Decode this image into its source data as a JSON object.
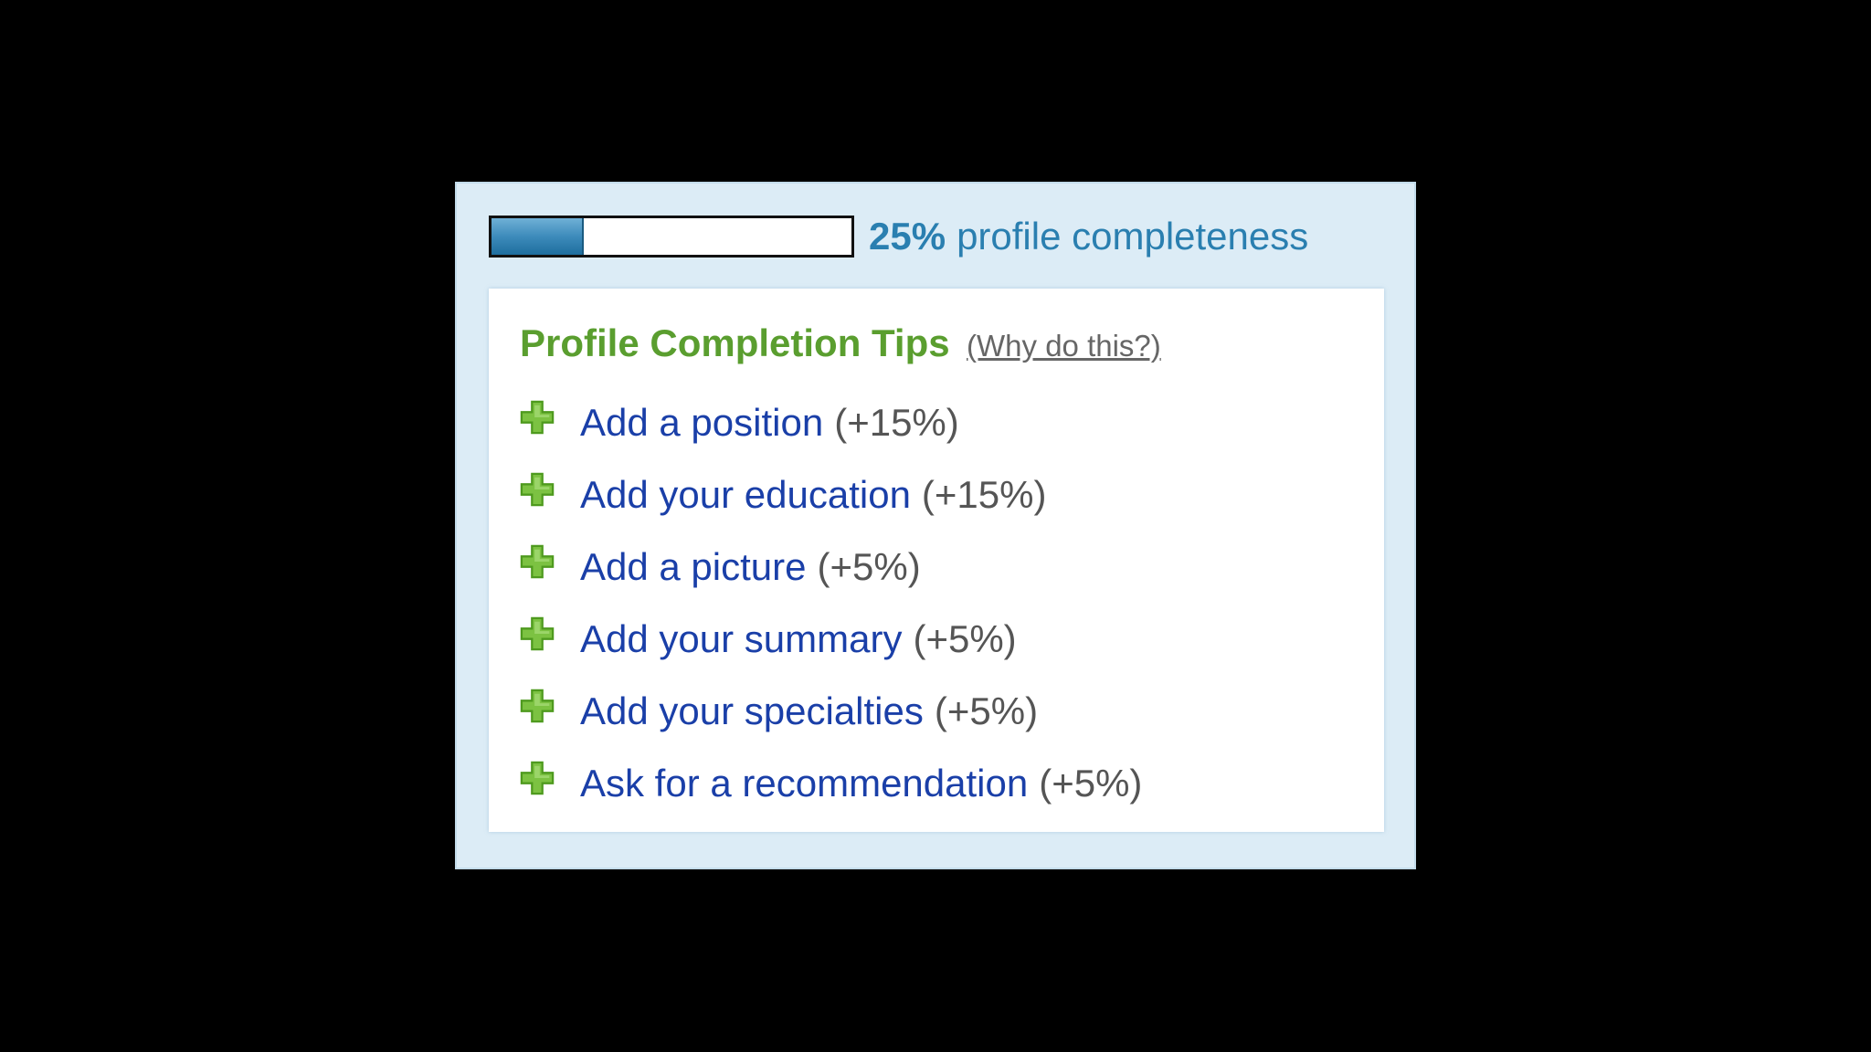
{
  "progress": {
    "percent_label": "25%",
    "label": "profile completeness",
    "fraction": 0.25
  },
  "tips": {
    "title": "Profile Completion Tips",
    "why_link": "(Why do this?)",
    "items": [
      {
        "label": "Add a position",
        "bonus": "(+15%)",
        "icon": "plus-icon"
      },
      {
        "label": "Add your education",
        "bonus": "(+15%)",
        "icon": "plus-icon"
      },
      {
        "label": "Add a picture",
        "bonus": "(+5%)",
        "icon": "plus-icon"
      },
      {
        "label": "Add your summary",
        "bonus": "(+5%)",
        "icon": "plus-icon"
      },
      {
        "label": "Add your specialties",
        "bonus": "(+5%)",
        "icon": "plus-icon"
      },
      {
        "label": "Ask for a recommendation",
        "bonus": "(+5%)",
        "icon": "plus-icon"
      }
    ]
  },
  "colors": {
    "progress_text": "#2a7fb0",
    "title_green": "#5a9e2f",
    "link_blue": "#1a3fa8",
    "panel_background": "#dcecf6"
  }
}
